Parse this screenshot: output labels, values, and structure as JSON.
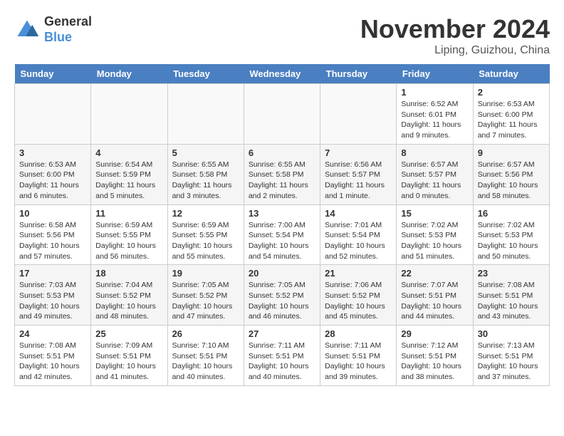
{
  "header": {
    "logo_general": "General",
    "logo_blue": "Blue",
    "month_title": "November 2024",
    "location": "Liping, Guizhou, China"
  },
  "days_of_week": [
    "Sunday",
    "Monday",
    "Tuesday",
    "Wednesday",
    "Thursday",
    "Friday",
    "Saturday"
  ],
  "weeks": [
    [
      {
        "day": "",
        "info": ""
      },
      {
        "day": "",
        "info": ""
      },
      {
        "day": "",
        "info": ""
      },
      {
        "day": "",
        "info": ""
      },
      {
        "day": "",
        "info": ""
      },
      {
        "day": "1",
        "info": "Sunrise: 6:52 AM\nSunset: 6:01 PM\nDaylight: 11 hours and 9 minutes."
      },
      {
        "day": "2",
        "info": "Sunrise: 6:53 AM\nSunset: 6:00 PM\nDaylight: 11 hours and 7 minutes."
      }
    ],
    [
      {
        "day": "3",
        "info": "Sunrise: 6:53 AM\nSunset: 6:00 PM\nDaylight: 11 hours and 6 minutes."
      },
      {
        "day": "4",
        "info": "Sunrise: 6:54 AM\nSunset: 5:59 PM\nDaylight: 11 hours and 5 minutes."
      },
      {
        "day": "5",
        "info": "Sunrise: 6:55 AM\nSunset: 5:58 PM\nDaylight: 11 hours and 3 minutes."
      },
      {
        "day": "6",
        "info": "Sunrise: 6:55 AM\nSunset: 5:58 PM\nDaylight: 11 hours and 2 minutes."
      },
      {
        "day": "7",
        "info": "Sunrise: 6:56 AM\nSunset: 5:57 PM\nDaylight: 11 hours and 1 minute."
      },
      {
        "day": "8",
        "info": "Sunrise: 6:57 AM\nSunset: 5:57 PM\nDaylight: 11 hours and 0 minutes."
      },
      {
        "day": "9",
        "info": "Sunrise: 6:57 AM\nSunset: 5:56 PM\nDaylight: 10 hours and 58 minutes."
      }
    ],
    [
      {
        "day": "10",
        "info": "Sunrise: 6:58 AM\nSunset: 5:56 PM\nDaylight: 10 hours and 57 minutes."
      },
      {
        "day": "11",
        "info": "Sunrise: 6:59 AM\nSunset: 5:55 PM\nDaylight: 10 hours and 56 minutes."
      },
      {
        "day": "12",
        "info": "Sunrise: 6:59 AM\nSunset: 5:55 PM\nDaylight: 10 hours and 55 minutes."
      },
      {
        "day": "13",
        "info": "Sunrise: 7:00 AM\nSunset: 5:54 PM\nDaylight: 10 hours and 54 minutes."
      },
      {
        "day": "14",
        "info": "Sunrise: 7:01 AM\nSunset: 5:54 PM\nDaylight: 10 hours and 52 minutes."
      },
      {
        "day": "15",
        "info": "Sunrise: 7:02 AM\nSunset: 5:53 PM\nDaylight: 10 hours and 51 minutes."
      },
      {
        "day": "16",
        "info": "Sunrise: 7:02 AM\nSunset: 5:53 PM\nDaylight: 10 hours and 50 minutes."
      }
    ],
    [
      {
        "day": "17",
        "info": "Sunrise: 7:03 AM\nSunset: 5:53 PM\nDaylight: 10 hours and 49 minutes."
      },
      {
        "day": "18",
        "info": "Sunrise: 7:04 AM\nSunset: 5:52 PM\nDaylight: 10 hours and 48 minutes."
      },
      {
        "day": "19",
        "info": "Sunrise: 7:05 AM\nSunset: 5:52 PM\nDaylight: 10 hours and 47 minutes."
      },
      {
        "day": "20",
        "info": "Sunrise: 7:05 AM\nSunset: 5:52 PM\nDaylight: 10 hours and 46 minutes."
      },
      {
        "day": "21",
        "info": "Sunrise: 7:06 AM\nSunset: 5:52 PM\nDaylight: 10 hours and 45 minutes."
      },
      {
        "day": "22",
        "info": "Sunrise: 7:07 AM\nSunset: 5:51 PM\nDaylight: 10 hours and 44 minutes."
      },
      {
        "day": "23",
        "info": "Sunrise: 7:08 AM\nSunset: 5:51 PM\nDaylight: 10 hours and 43 minutes."
      }
    ],
    [
      {
        "day": "24",
        "info": "Sunrise: 7:08 AM\nSunset: 5:51 PM\nDaylight: 10 hours and 42 minutes."
      },
      {
        "day": "25",
        "info": "Sunrise: 7:09 AM\nSunset: 5:51 PM\nDaylight: 10 hours and 41 minutes."
      },
      {
        "day": "26",
        "info": "Sunrise: 7:10 AM\nSunset: 5:51 PM\nDaylight: 10 hours and 40 minutes."
      },
      {
        "day": "27",
        "info": "Sunrise: 7:11 AM\nSunset: 5:51 PM\nDaylight: 10 hours and 40 minutes."
      },
      {
        "day": "28",
        "info": "Sunrise: 7:11 AM\nSunset: 5:51 PM\nDaylight: 10 hours and 39 minutes."
      },
      {
        "day": "29",
        "info": "Sunrise: 7:12 AM\nSunset: 5:51 PM\nDaylight: 10 hours and 38 minutes."
      },
      {
        "day": "30",
        "info": "Sunrise: 7:13 AM\nSunset: 5:51 PM\nDaylight: 10 hours and 37 minutes."
      }
    ]
  ]
}
